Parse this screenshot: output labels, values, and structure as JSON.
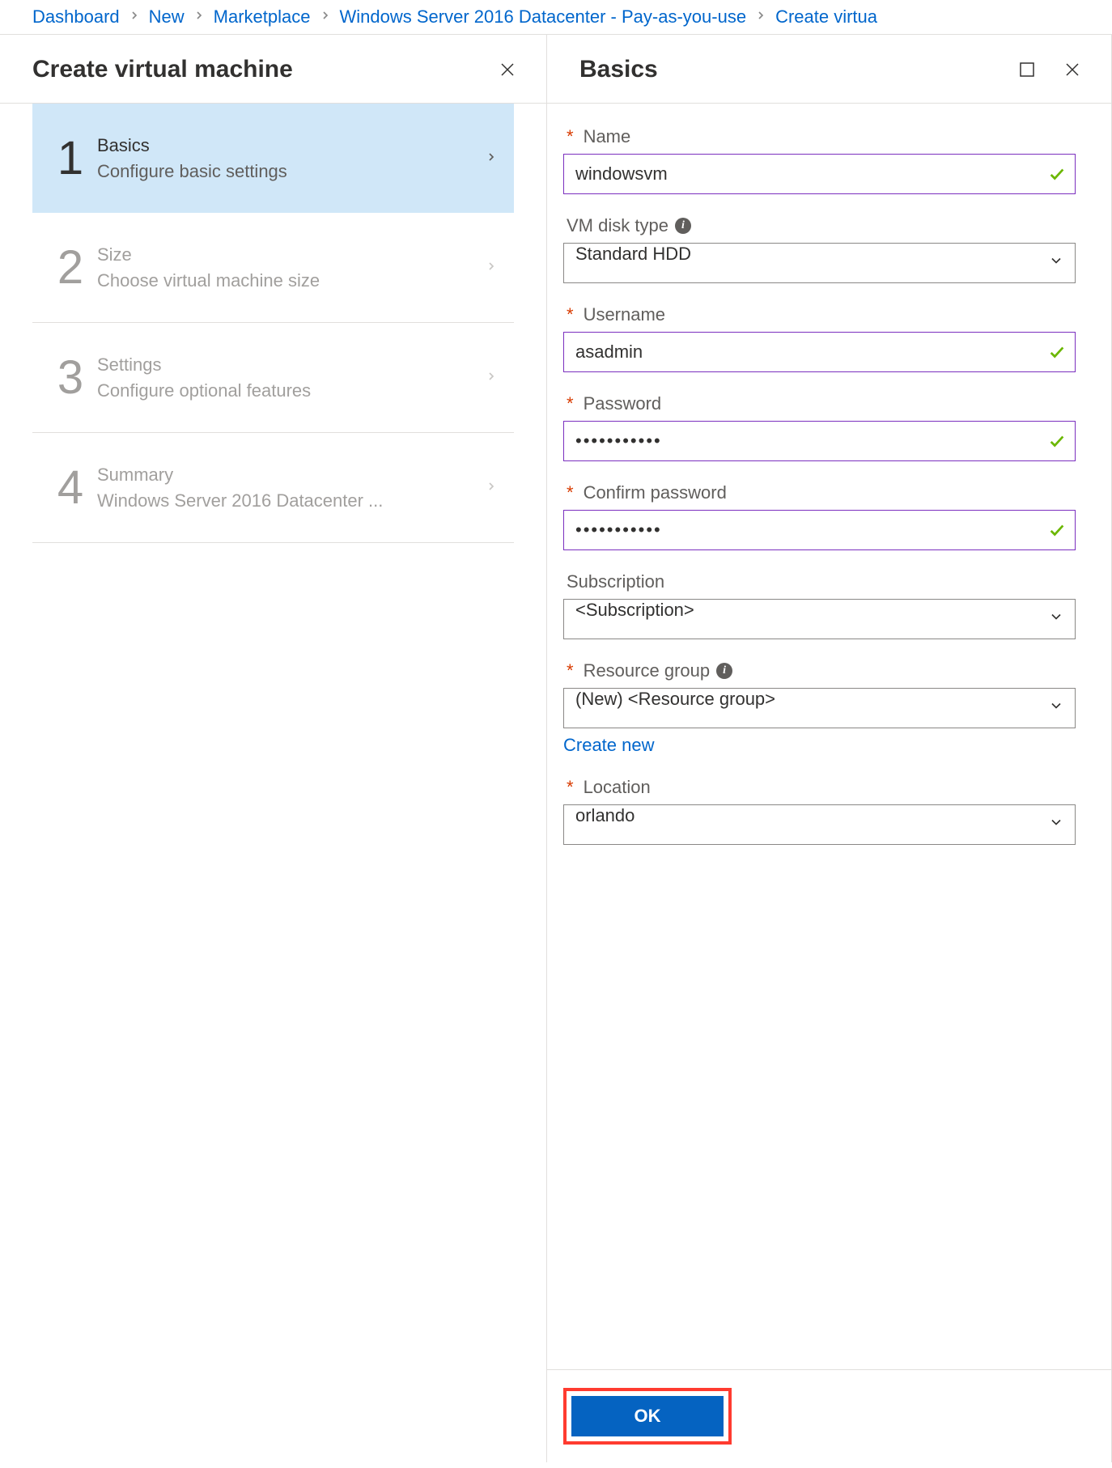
{
  "breadcrumb": {
    "items": [
      "Dashboard",
      "New",
      "Marketplace",
      "Windows Server 2016 Datacenter - Pay-as-you-use",
      "Create virtua"
    ]
  },
  "left_blade": {
    "title": "Create virtual machine",
    "steps": [
      {
        "num": "1",
        "title": "Basics",
        "sub": "Configure basic settings",
        "active": true
      },
      {
        "num": "2",
        "title": "Size",
        "sub": "Choose virtual machine size",
        "active": false
      },
      {
        "num": "3",
        "title": "Settings",
        "sub": "Configure optional features",
        "active": false
      },
      {
        "num": "4",
        "title": "Summary",
        "sub": "Windows Server 2016 Datacenter ...",
        "active": false
      }
    ]
  },
  "right_blade": {
    "title": "Basics",
    "fields": {
      "name": {
        "label": "Name",
        "value": "windowsvm",
        "required": true,
        "valid": true
      },
      "disk_type": {
        "label": "VM disk type",
        "value": "Standard HDD",
        "required": false,
        "info": true
      },
      "username": {
        "label": "Username",
        "value": "asadmin",
        "required": true,
        "valid": true
      },
      "password": {
        "label": "Password",
        "value": "•••••••••••",
        "required": true,
        "valid": true
      },
      "confirm_password": {
        "label": "Confirm password",
        "value": "•••••••••••",
        "required": true,
        "valid": true
      },
      "subscription": {
        "label": "Subscription",
        "value": "<Subscription>",
        "required": false
      },
      "resource_group": {
        "label": "Resource group",
        "value": "(New)  <Resource group>",
        "required": true,
        "info": true,
        "create_link": "Create new"
      },
      "location": {
        "label": "Location",
        "value": "orlando",
        "required": true
      }
    },
    "ok_button": "OK"
  }
}
